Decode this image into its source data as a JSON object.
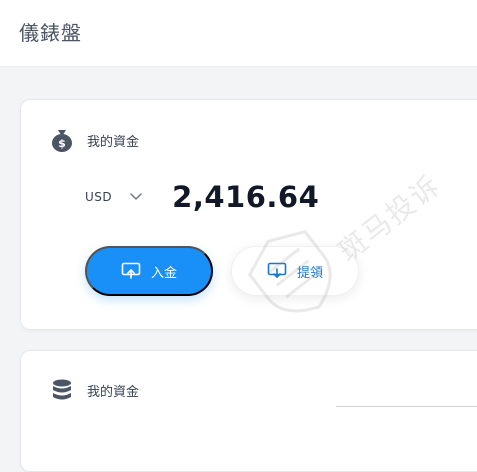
{
  "header": {
    "title": "儀錶盤"
  },
  "cards": [
    {
      "title": "我的資金",
      "icon": "money-bag-icon",
      "currency": "USD",
      "amount": "2,416.64",
      "actions": {
        "deposit_label": "入金",
        "withdraw_label": "提領"
      }
    },
    {
      "title": "我的資金",
      "icon": "coin-stack-icon"
    }
  ],
  "watermark": {
    "text": "斑马投诉"
  },
  "colors": {
    "primary": "#1890f7",
    "link": "#1677d2",
    "background": "#f3f4f6"
  }
}
